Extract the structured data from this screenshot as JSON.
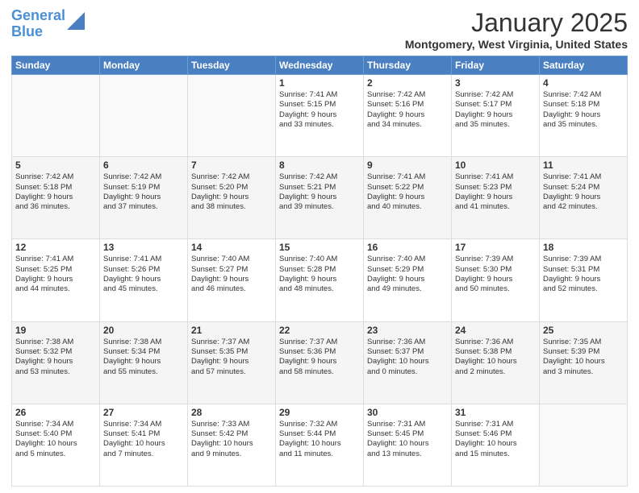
{
  "header": {
    "logo_line1": "General",
    "logo_line2": "Blue",
    "month_title": "January 2025",
    "location": "Montgomery, West Virginia, United States"
  },
  "weekdays": [
    "Sunday",
    "Monday",
    "Tuesday",
    "Wednesday",
    "Thursday",
    "Friday",
    "Saturday"
  ],
  "weeks": [
    [
      {
        "day": "",
        "content": ""
      },
      {
        "day": "",
        "content": ""
      },
      {
        "day": "",
        "content": ""
      },
      {
        "day": "1",
        "content": "Sunrise: 7:41 AM\nSunset: 5:15 PM\nDaylight: 9 hours\nand 33 minutes."
      },
      {
        "day": "2",
        "content": "Sunrise: 7:42 AM\nSunset: 5:16 PM\nDaylight: 9 hours\nand 34 minutes."
      },
      {
        "day": "3",
        "content": "Sunrise: 7:42 AM\nSunset: 5:17 PM\nDaylight: 9 hours\nand 35 minutes."
      },
      {
        "day": "4",
        "content": "Sunrise: 7:42 AM\nSunset: 5:18 PM\nDaylight: 9 hours\nand 35 minutes."
      }
    ],
    [
      {
        "day": "5",
        "content": "Sunrise: 7:42 AM\nSunset: 5:18 PM\nDaylight: 9 hours\nand 36 minutes."
      },
      {
        "day": "6",
        "content": "Sunrise: 7:42 AM\nSunset: 5:19 PM\nDaylight: 9 hours\nand 37 minutes."
      },
      {
        "day": "7",
        "content": "Sunrise: 7:42 AM\nSunset: 5:20 PM\nDaylight: 9 hours\nand 38 minutes."
      },
      {
        "day": "8",
        "content": "Sunrise: 7:42 AM\nSunset: 5:21 PM\nDaylight: 9 hours\nand 39 minutes."
      },
      {
        "day": "9",
        "content": "Sunrise: 7:41 AM\nSunset: 5:22 PM\nDaylight: 9 hours\nand 40 minutes."
      },
      {
        "day": "10",
        "content": "Sunrise: 7:41 AM\nSunset: 5:23 PM\nDaylight: 9 hours\nand 41 minutes."
      },
      {
        "day": "11",
        "content": "Sunrise: 7:41 AM\nSunset: 5:24 PM\nDaylight: 9 hours\nand 42 minutes."
      }
    ],
    [
      {
        "day": "12",
        "content": "Sunrise: 7:41 AM\nSunset: 5:25 PM\nDaylight: 9 hours\nand 44 minutes."
      },
      {
        "day": "13",
        "content": "Sunrise: 7:41 AM\nSunset: 5:26 PM\nDaylight: 9 hours\nand 45 minutes."
      },
      {
        "day": "14",
        "content": "Sunrise: 7:40 AM\nSunset: 5:27 PM\nDaylight: 9 hours\nand 46 minutes."
      },
      {
        "day": "15",
        "content": "Sunrise: 7:40 AM\nSunset: 5:28 PM\nDaylight: 9 hours\nand 48 minutes."
      },
      {
        "day": "16",
        "content": "Sunrise: 7:40 AM\nSunset: 5:29 PM\nDaylight: 9 hours\nand 49 minutes."
      },
      {
        "day": "17",
        "content": "Sunrise: 7:39 AM\nSunset: 5:30 PM\nDaylight: 9 hours\nand 50 minutes."
      },
      {
        "day": "18",
        "content": "Sunrise: 7:39 AM\nSunset: 5:31 PM\nDaylight: 9 hours\nand 52 minutes."
      }
    ],
    [
      {
        "day": "19",
        "content": "Sunrise: 7:38 AM\nSunset: 5:32 PM\nDaylight: 9 hours\nand 53 minutes."
      },
      {
        "day": "20",
        "content": "Sunrise: 7:38 AM\nSunset: 5:34 PM\nDaylight: 9 hours\nand 55 minutes."
      },
      {
        "day": "21",
        "content": "Sunrise: 7:37 AM\nSunset: 5:35 PM\nDaylight: 9 hours\nand 57 minutes."
      },
      {
        "day": "22",
        "content": "Sunrise: 7:37 AM\nSunset: 5:36 PM\nDaylight: 9 hours\nand 58 minutes."
      },
      {
        "day": "23",
        "content": "Sunrise: 7:36 AM\nSunset: 5:37 PM\nDaylight: 10 hours\nand 0 minutes."
      },
      {
        "day": "24",
        "content": "Sunrise: 7:36 AM\nSunset: 5:38 PM\nDaylight: 10 hours\nand 2 minutes."
      },
      {
        "day": "25",
        "content": "Sunrise: 7:35 AM\nSunset: 5:39 PM\nDaylight: 10 hours\nand 3 minutes."
      }
    ],
    [
      {
        "day": "26",
        "content": "Sunrise: 7:34 AM\nSunset: 5:40 PM\nDaylight: 10 hours\nand 5 minutes."
      },
      {
        "day": "27",
        "content": "Sunrise: 7:34 AM\nSunset: 5:41 PM\nDaylight: 10 hours\nand 7 minutes."
      },
      {
        "day": "28",
        "content": "Sunrise: 7:33 AM\nSunset: 5:42 PM\nDaylight: 10 hours\nand 9 minutes."
      },
      {
        "day": "29",
        "content": "Sunrise: 7:32 AM\nSunset: 5:44 PM\nDaylight: 10 hours\nand 11 minutes."
      },
      {
        "day": "30",
        "content": "Sunrise: 7:31 AM\nSunset: 5:45 PM\nDaylight: 10 hours\nand 13 minutes."
      },
      {
        "day": "31",
        "content": "Sunrise: 7:31 AM\nSunset: 5:46 PM\nDaylight: 10 hours\nand 15 minutes."
      },
      {
        "day": "",
        "content": ""
      }
    ]
  ]
}
